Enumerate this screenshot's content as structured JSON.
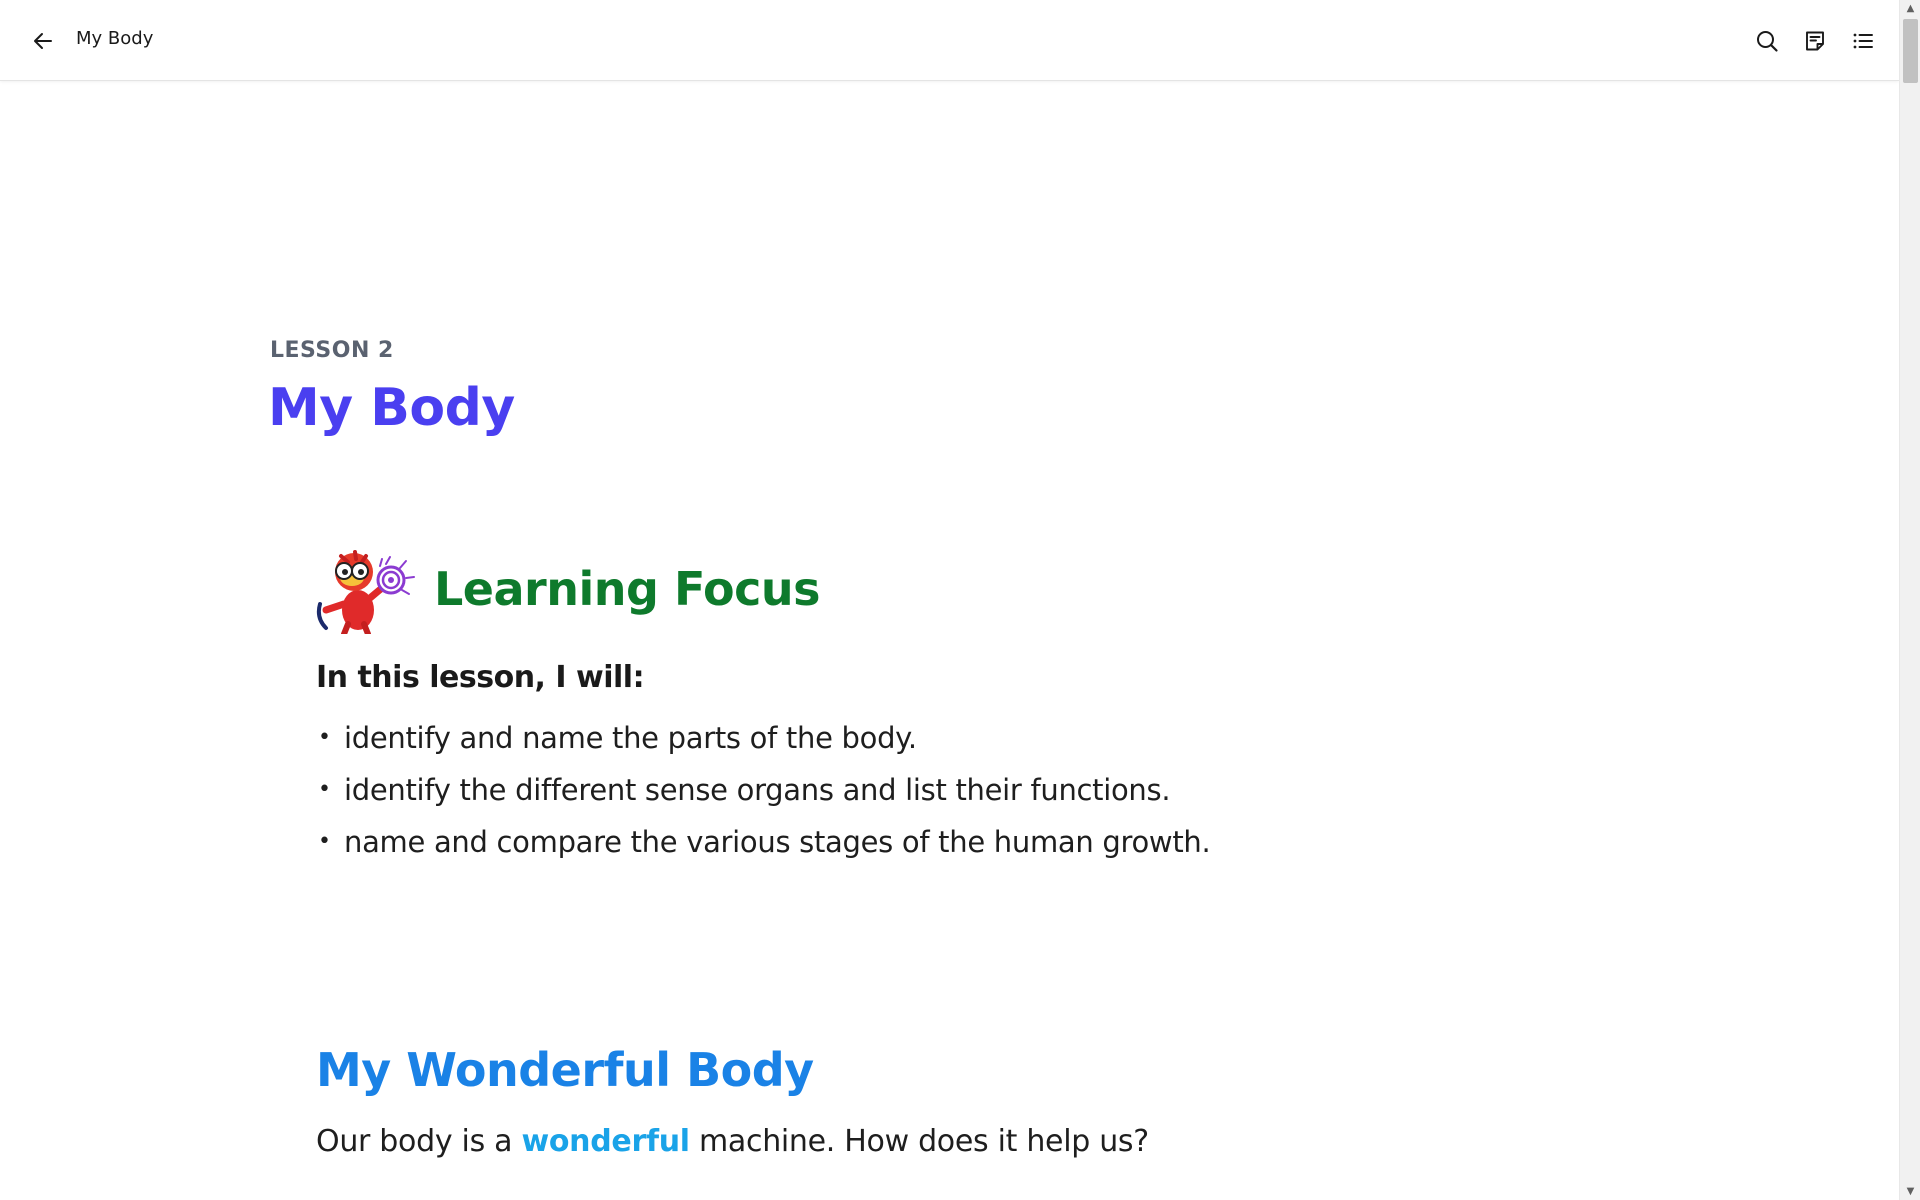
{
  "header": {
    "back_icon": "arrow-left-icon",
    "title": "My Body",
    "tools": [
      {
        "name": "search-icon"
      },
      {
        "name": "notes-icon"
      },
      {
        "name": "table-of-contents-icon"
      }
    ]
  },
  "lesson": {
    "label": "LESSON 2",
    "title": "My Body"
  },
  "learning_focus": {
    "heading": "Learning Focus",
    "intro": "In this lesson, I will:",
    "objectives": [
      "identify and name the parts of the body.",
      "identify the different sense organs and list their functions.",
      "name and compare the various stages of the human growth."
    ]
  },
  "section": {
    "title": "My Wonderful Body",
    "para_before": "Our body is a ",
    "para_highlight": "wonderful",
    "para_after": " machine. How does it help us?"
  },
  "colors": {
    "lesson_title": "#4a3ff0",
    "focus_heading": "#0e7a2c",
    "section_title": "#1a82e6",
    "highlight": "#1aa3e8"
  }
}
